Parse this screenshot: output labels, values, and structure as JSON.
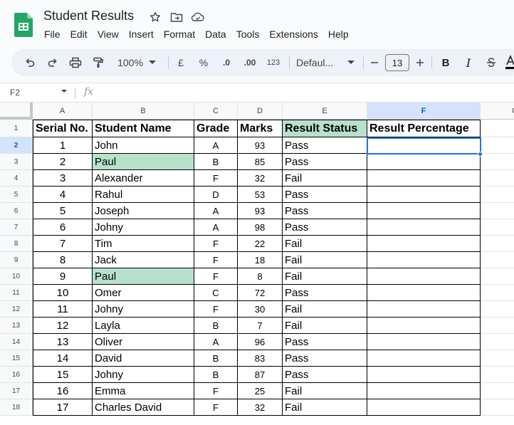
{
  "app": {
    "title": "Student Results",
    "menu": [
      "File",
      "Edit",
      "View",
      "Insert",
      "Format",
      "Data",
      "Tools",
      "Extensions",
      "Help"
    ]
  },
  "toolbar": {
    "zoom": "100%",
    "currency": "£",
    "percent": "%",
    "dec_decrease": ".0",
    "dec_increase": ".00",
    "number_format": "123",
    "font": "Defaul...",
    "font_size": "13",
    "bold": "B",
    "italic": "I"
  },
  "formula_bar": {
    "name_box": "F2",
    "fx": "fx",
    "value": ""
  },
  "grid": {
    "columns": [
      "A",
      "B",
      "C",
      "D",
      "E",
      "F",
      "G"
    ],
    "selected_column": "F",
    "selected_row": 2,
    "header_row": {
      "serial": "Serial No.",
      "name": "Student  Name",
      "grade": "Grade",
      "marks": "Marks",
      "status": "Result Status",
      "percentage": "Result Percentage"
    },
    "rows": [
      {
        "row": "2",
        "serial": "1",
        "name": "John",
        "grade": "A",
        "marks": "93",
        "status": "Pass",
        "name_highlight": false
      },
      {
        "row": "3",
        "serial": "2",
        "name": "Paul",
        "grade": "B",
        "marks": "85",
        "status": "Pass",
        "name_highlight": true
      },
      {
        "row": "4",
        "serial": "3",
        "name": "Alexander",
        "grade": "F",
        "marks": "32",
        "status": "Fail",
        "name_highlight": false
      },
      {
        "row": "5",
        "serial": "4",
        "name": "Rahul",
        "grade": "D",
        "marks": "53",
        "status": "Pass",
        "name_highlight": false
      },
      {
        "row": "6",
        "serial": "5",
        "name": "Joseph",
        "grade": "A",
        "marks": "93",
        "status": "Pass",
        "name_highlight": false
      },
      {
        "row": "7",
        "serial": "6",
        "name": "Johny",
        "grade": "A",
        "marks": "98",
        "status": "Pass",
        "name_highlight": false
      },
      {
        "row": "8",
        "serial": "7",
        "name": "Tim",
        "grade": "F",
        "marks": "22",
        "status": "Fail",
        "name_highlight": false
      },
      {
        "row": "9",
        "serial": "8",
        "name": "Jack",
        "grade": "F",
        "marks": "18",
        "status": "Fail",
        "name_highlight": false
      },
      {
        "row": "10",
        "serial": "9",
        "name": "Paul",
        "grade": "F",
        "marks": "8",
        "status": "Fail",
        "name_highlight": true
      },
      {
        "row": "11",
        "serial": "10",
        "name": "Omer",
        "grade": "C",
        "marks": "72",
        "status": "Pass",
        "name_highlight": false
      },
      {
        "row": "12",
        "serial": "11",
        "name": "Johny",
        "grade": "F",
        "marks": "30",
        "status": "Fail",
        "name_highlight": false
      },
      {
        "row": "13",
        "serial": "12",
        "name": "Layla",
        "grade": "B",
        "marks": "7",
        "status": "Fail",
        "name_highlight": false
      },
      {
        "row": "14",
        "serial": "13",
        "name": "Oliver",
        "grade": "A",
        "marks": "96",
        "status": "Pass",
        "name_highlight": false
      },
      {
        "row": "15",
        "serial": "14",
        "name": "David",
        "grade": "B",
        "marks": "83",
        "status": "Pass",
        "name_highlight": false
      },
      {
        "row": "16",
        "serial": "15",
        "name": "Johny",
        "grade": "B",
        "marks": "87",
        "status": "Pass",
        "name_highlight": false
      },
      {
        "row": "17",
        "serial": "16",
        "name": "Emma",
        "grade": "F",
        "marks": "25",
        "status": "Fail",
        "name_highlight": false
      },
      {
        "row": "18",
        "serial": "17",
        "name": "Charles  David",
        "grade": "F",
        "marks": "32",
        "status": "Fail",
        "name_highlight": false
      }
    ]
  },
  "colors": {
    "name_highlight": "#b7e1cd",
    "status_header": "#b7e1cd",
    "selection": "#1a73e8"
  }
}
